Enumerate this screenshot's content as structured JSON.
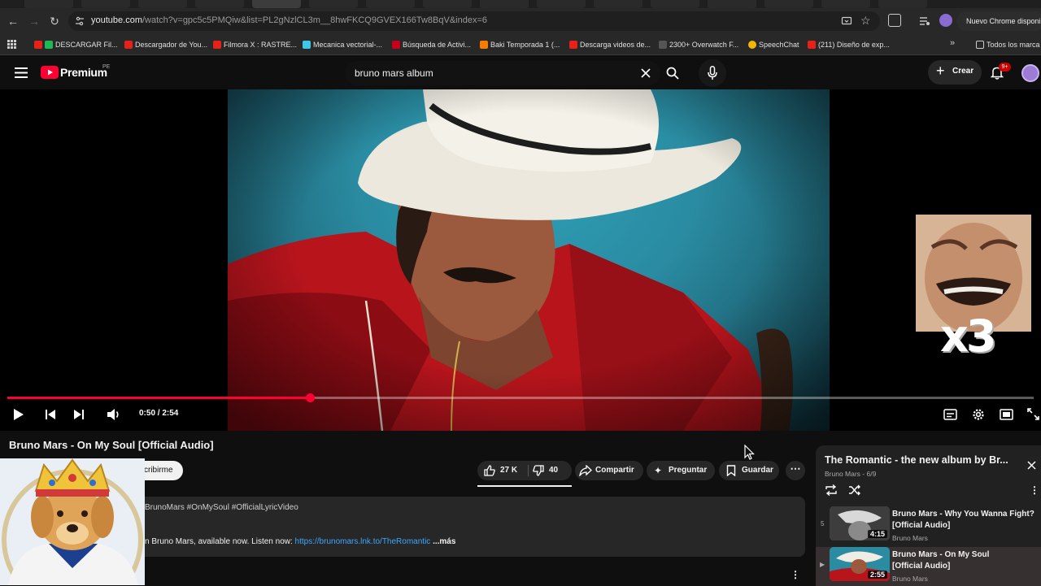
{
  "browser": {
    "url_main": "youtube.com",
    "url_rest": "/watch?v=gpc5c5PMQiw&list=PL2gNzlCL3m__8hwFKCQ9GVEX166Tw8BqV&index=6",
    "update_label": "Nuevo Chrome disponible",
    "bookmarks": [
      "DESCARGAR Fil...",
      "Descargador de You...",
      "Filmora X : RASTRE...",
      "Mecanica vectorial-...",
      "Búsqueda de Activi...",
      "Baki Temporada 1 (...",
      "Descarga videos de...",
      "2300+ Overwatch F...",
      "SpeechChat",
      "(211) Diseño de exp..."
    ],
    "bookmarks_more": "Todos los marca"
  },
  "yt": {
    "logo": "Premium",
    "logo_region": "PE",
    "search_value": "bruno mars album",
    "create_label": "Crear",
    "notif_count": "9+"
  },
  "player": {
    "time": "0:50 / 2:54",
    "progress": 0.295,
    "overlay_text": "x3"
  },
  "video": {
    "title": "Bruno Mars - On My Soul [Official Audio]",
    "subscribe": "cribirme",
    "likes": "27 K",
    "dislikes": "40",
    "share": "Compartir",
    "ask": "Preguntar",
    "save": "Guardar",
    "hashtags": "BrunoMars #OnMySoul #OfficialLyricVideo",
    "desc_prefix": "n Bruno Mars, available now. Listen now: ",
    "desc_link": "https://brunomars.lnk.to/TheRomantic",
    "desc_more": "...más"
  },
  "playlist": {
    "title": "The Romantic - the new album by Br...",
    "subtitle": "Bruno Mars - 6/9",
    "items": [
      {
        "index": "5",
        "title": "Bruno Mars - Why You Wanna Fight? [Official Audio]",
        "channel": "Bruno Mars",
        "duration": "4:15"
      },
      {
        "index": "▶",
        "title": "Bruno Mars - On My Soul [Official Audio]",
        "channel": "Bruno Mars",
        "duration": "2:55"
      }
    ]
  }
}
